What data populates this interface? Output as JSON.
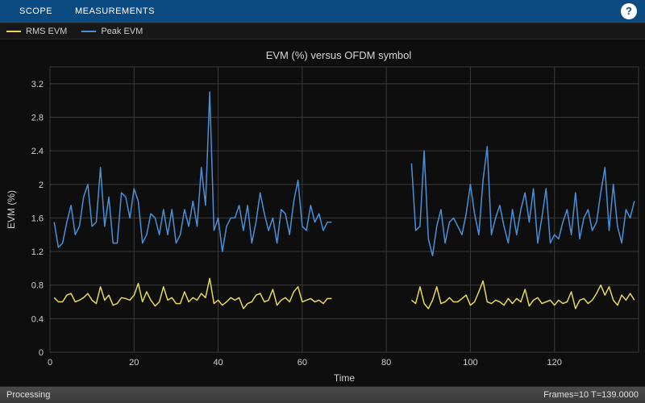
{
  "toolbar": {
    "tab_scope": "SCOPE",
    "tab_measurements": "MEASUREMENTS",
    "help_label": "?"
  },
  "legend": {
    "items": [
      {
        "color": "#e6d85c",
        "label": "RMS EVM"
      },
      {
        "color": "#4a90d9",
        "label": "Peak EVM"
      }
    ]
  },
  "status": {
    "left": "Processing",
    "right": "Frames=10  T=139.0000"
  },
  "chart_data": {
    "type": "line",
    "title": "EVM (%) versus OFDM symbol",
    "xlabel": "Time",
    "ylabel": "EVM (%)",
    "xlim": [
      0,
      140
    ],
    "ylim": [
      0,
      3.4
    ],
    "xticks": [
      0,
      20,
      40,
      60,
      80,
      100,
      120
    ],
    "yticks": [
      0,
      0.4,
      0.8,
      1.2,
      1.6,
      2.0,
      2.4,
      2.8,
      3.2
    ],
    "x": [
      1,
      2,
      3,
      4,
      5,
      6,
      7,
      8,
      9,
      10,
      11,
      12,
      13,
      14,
      15,
      16,
      17,
      18,
      19,
      20,
      21,
      22,
      23,
      24,
      25,
      26,
      27,
      28,
      29,
      30,
      31,
      32,
      33,
      34,
      35,
      36,
      37,
      38,
      39,
      40,
      41,
      42,
      43,
      44,
      45,
      46,
      47,
      48,
      49,
      50,
      51,
      52,
      53,
      54,
      55,
      56,
      57,
      58,
      59,
      60,
      61,
      62,
      63,
      64,
      65,
      66,
      67,
      86,
      87,
      88,
      89,
      90,
      91,
      92,
      93,
      94,
      95,
      96,
      97,
      98,
      99,
      100,
      101,
      102,
      103,
      104,
      105,
      106,
      107,
      108,
      109,
      110,
      111,
      112,
      113,
      114,
      115,
      116,
      117,
      118,
      119,
      120,
      121,
      122,
      123,
      124,
      125,
      126,
      127,
      128,
      129,
      130,
      131,
      132,
      133,
      134,
      135,
      136,
      137,
      138,
      139
    ],
    "series": [
      {
        "name": "Peak EVM",
        "color": "#4a90d9",
        "values": [
          1.55,
          1.25,
          1.3,
          1.55,
          1.75,
          1.4,
          1.5,
          1.85,
          2.0,
          1.5,
          1.55,
          2.2,
          1.5,
          1.85,
          1.3,
          1.3,
          1.9,
          1.85,
          1.6,
          1.95,
          1.8,
          1.3,
          1.4,
          1.65,
          1.6,
          1.4,
          1.7,
          1.4,
          1.7,
          1.3,
          1.4,
          1.7,
          1.5,
          1.8,
          1.5,
          2.2,
          1.75,
          3.1,
          1.45,
          1.6,
          1.2,
          1.5,
          1.6,
          1.6,
          1.75,
          1.45,
          1.75,
          1.3,
          1.55,
          1.9,
          1.65,
          1.45,
          1.6,
          1.3,
          1.7,
          1.65,
          1.4,
          1.8,
          2.05,
          1.5,
          1.45,
          1.75,
          1.55,
          1.65,
          1.45,
          1.55,
          1.55,
          2.25,
          1.45,
          1.5,
          2.4,
          1.35,
          1.15,
          1.5,
          1.7,
          1.3,
          1.55,
          1.6,
          1.5,
          1.4,
          1.65,
          2.0,
          1.65,
          1.4,
          2.05,
          2.45,
          1.4,
          1.6,
          1.75,
          1.5,
          1.3,
          1.7,
          1.4,
          1.7,
          1.9,
          1.55,
          1.95,
          1.3,
          1.6,
          1.95,
          1.3,
          1.4,
          1.35,
          1.55,
          1.7,
          1.4,
          1.9,
          1.35,
          1.6,
          1.7,
          1.45,
          1.55,
          1.9,
          2.2,
          1.45,
          2.0,
          1.5,
          1.3,
          1.7,
          1.6,
          1.8
        ]
      },
      {
        "name": "RMS EVM",
        "color": "#e6d85c",
        "values": [
          0.65,
          0.6,
          0.6,
          0.68,
          0.7,
          0.6,
          0.62,
          0.65,
          0.7,
          0.62,
          0.58,
          0.78,
          0.62,
          0.68,
          0.56,
          0.58,
          0.65,
          0.64,
          0.62,
          0.68,
          0.82,
          0.6,
          0.72,
          0.62,
          0.55,
          0.6,
          0.78,
          0.62,
          0.65,
          0.58,
          0.58,
          0.72,
          0.6,
          0.65,
          0.62,
          0.7,
          0.65,
          0.88,
          0.58,
          0.62,
          0.56,
          0.6,
          0.65,
          0.62,
          0.65,
          0.52,
          0.58,
          0.6,
          0.68,
          0.7,
          0.6,
          0.62,
          0.75,
          0.56,
          0.62,
          0.65,
          0.6,
          0.72,
          0.78,
          0.6,
          0.62,
          0.64,
          0.6,
          0.62,
          0.58,
          0.64,
          0.64,
          0.62,
          0.58,
          0.78,
          0.58,
          0.52,
          0.62,
          0.78,
          0.58,
          0.6,
          0.65,
          0.6,
          0.6,
          0.64,
          0.68,
          0.56,
          0.6,
          0.72,
          0.85,
          0.6,
          0.58,
          0.62,
          0.6,
          0.56,
          0.64,
          0.58,
          0.64,
          0.6,
          0.75,
          0.55,
          0.62,
          0.65,
          0.58,
          0.6,
          0.62,
          0.56,
          0.62,
          0.58,
          0.6,
          0.72,
          0.52,
          0.62,
          0.64,
          0.58,
          0.62,
          0.7,
          0.8,
          0.68,
          0.78,
          0.62,
          0.56,
          0.68,
          0.62,
          0.7,
          0.62
        ]
      }
    ]
  }
}
